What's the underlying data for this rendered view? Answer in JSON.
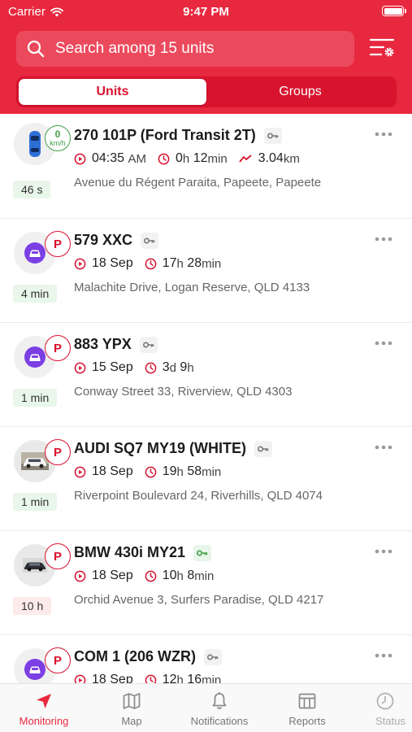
{
  "status_bar": {
    "carrier": "Carrier",
    "time": "9:47 PM"
  },
  "search": {
    "placeholder": "Search among 15 units"
  },
  "segments": {
    "units": "Units",
    "groups": "Groups"
  },
  "units": [
    {
      "name": "270 101P (Ford Transit 2T)",
      "badge": "speed",
      "speed_value": "0",
      "speed_unit": "km/h",
      "ago": "46 s",
      "ago_status": "ok",
      "date": "04:35",
      "date_suffix": "AM",
      "dur_h": "0",
      "dur_h_unit": "h",
      "dur_m": "12",
      "dur_m_unit": "min",
      "distance": "3.04",
      "distance_unit": "km",
      "address": "Avenue du Régent Paraita, Papeete, Papeete",
      "avatar": "car-blue",
      "key_color": "grey"
    },
    {
      "name": "579 XXC",
      "badge": "P",
      "ago": "4 min",
      "ago_status": "ok",
      "date": "18 Sep",
      "dur_h": "17",
      "dur_h_unit": "h",
      "dur_m": "28",
      "dur_m_unit": "min",
      "address": "Malachite Drive, Logan Reserve, QLD 4133",
      "avatar": "car-purple",
      "key_color": "grey"
    },
    {
      "name": "883 YPX",
      "badge": "P",
      "ago": "1 min",
      "ago_status": "ok",
      "date": "15 Sep",
      "dur_h": "3",
      "dur_h_unit": "d",
      "dur_m": "9",
      "dur_m_unit": "h",
      "address": "Conway Street 33, Riverview, QLD 4303",
      "avatar": "car-purple",
      "key_color": "grey"
    },
    {
      "name": "AUDI SQ7 MY19 (WHITE)",
      "badge": "P",
      "ago": "1 min",
      "ago_status": "ok",
      "date": "18 Sep",
      "dur_h": "19",
      "dur_h_unit": "h",
      "dur_m": "58",
      "dur_m_unit": "min",
      "address": "Riverpoint Boulevard 24, Riverhills, QLD 4074",
      "avatar": "photo-white-suv",
      "key_color": "grey"
    },
    {
      "name": "BMW 430i MY21",
      "badge": "P",
      "ago": "10 h",
      "ago_status": "warn",
      "date": "18 Sep",
      "dur_h": "10",
      "dur_h_unit": "h",
      "dur_m": "8",
      "dur_m_unit": "min",
      "address": "Orchid Avenue 3, Surfers Paradise, QLD 4217",
      "avatar": "photo-dark-sedan",
      "key_color": "green"
    },
    {
      "name": "COM 1 (206 WZR)",
      "badge": "P",
      "ago": "",
      "ago_status": "ok",
      "date": "18 Sep",
      "dur_h": "12",
      "dur_h_unit": "h",
      "dur_m": "16",
      "dur_m_unit": "min",
      "address": "",
      "avatar": "car-purple",
      "key_color": "grey"
    }
  ],
  "tabbar": [
    {
      "label": "Monitoring",
      "icon": "navigation-arrow-icon",
      "active": true
    },
    {
      "label": "Map",
      "icon": "map-icon",
      "active": false
    },
    {
      "label": "Notifications",
      "icon": "bell-icon",
      "active": false
    },
    {
      "label": "Reports",
      "icon": "reports-icon",
      "active": false
    },
    {
      "label": "Status",
      "icon": "status-clock-icon",
      "active": false
    }
  ],
  "colors": {
    "brand": "#e8283f",
    "brand_dark": "#d8132e",
    "ok": "#43a047",
    "purple": "#7b3fe4"
  }
}
